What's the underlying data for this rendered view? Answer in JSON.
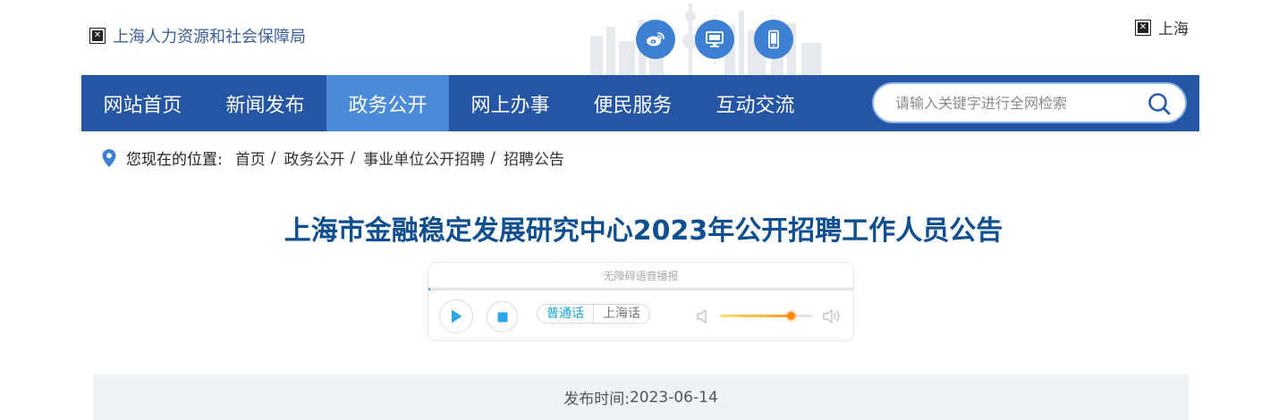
{
  "header": {
    "site_name": "上海人力资源和社会保障局",
    "region_label": "上海",
    "social": [
      {
        "icon": "weibo-icon"
      },
      {
        "icon": "desktop-icon"
      },
      {
        "icon": "mobile-icon"
      }
    ]
  },
  "nav": {
    "items": [
      {
        "label": "网站首页",
        "active": false
      },
      {
        "label": "新闻发布",
        "active": false
      },
      {
        "label": "政务公开",
        "active": true
      },
      {
        "label": "网上办事",
        "active": false
      },
      {
        "label": "便民服务",
        "active": false
      },
      {
        "label": "互动交流",
        "active": false
      }
    ],
    "search": {
      "placeholder": "请输入关键字进行全网检索",
      "value": ""
    },
    "colors": {
      "bar": "#2555a5",
      "active": "#4a8ad7"
    }
  },
  "breadcrumb": {
    "label": "您现在的位置:",
    "items": [
      "首页",
      "政务公开",
      "事业单位公开招聘",
      "招聘公告"
    ]
  },
  "article": {
    "title": "上海市金融稳定发展研究中心2023年公开招聘工作人员公告",
    "publish_label": "发布时间:",
    "publish_date": "2023-06-14"
  },
  "player": {
    "caption": "无障碍语音播报",
    "languages": [
      {
        "label": "普通话",
        "active": true
      },
      {
        "label": "上海话",
        "active": false
      }
    ],
    "volume": 0.76,
    "progress": 0.0
  }
}
